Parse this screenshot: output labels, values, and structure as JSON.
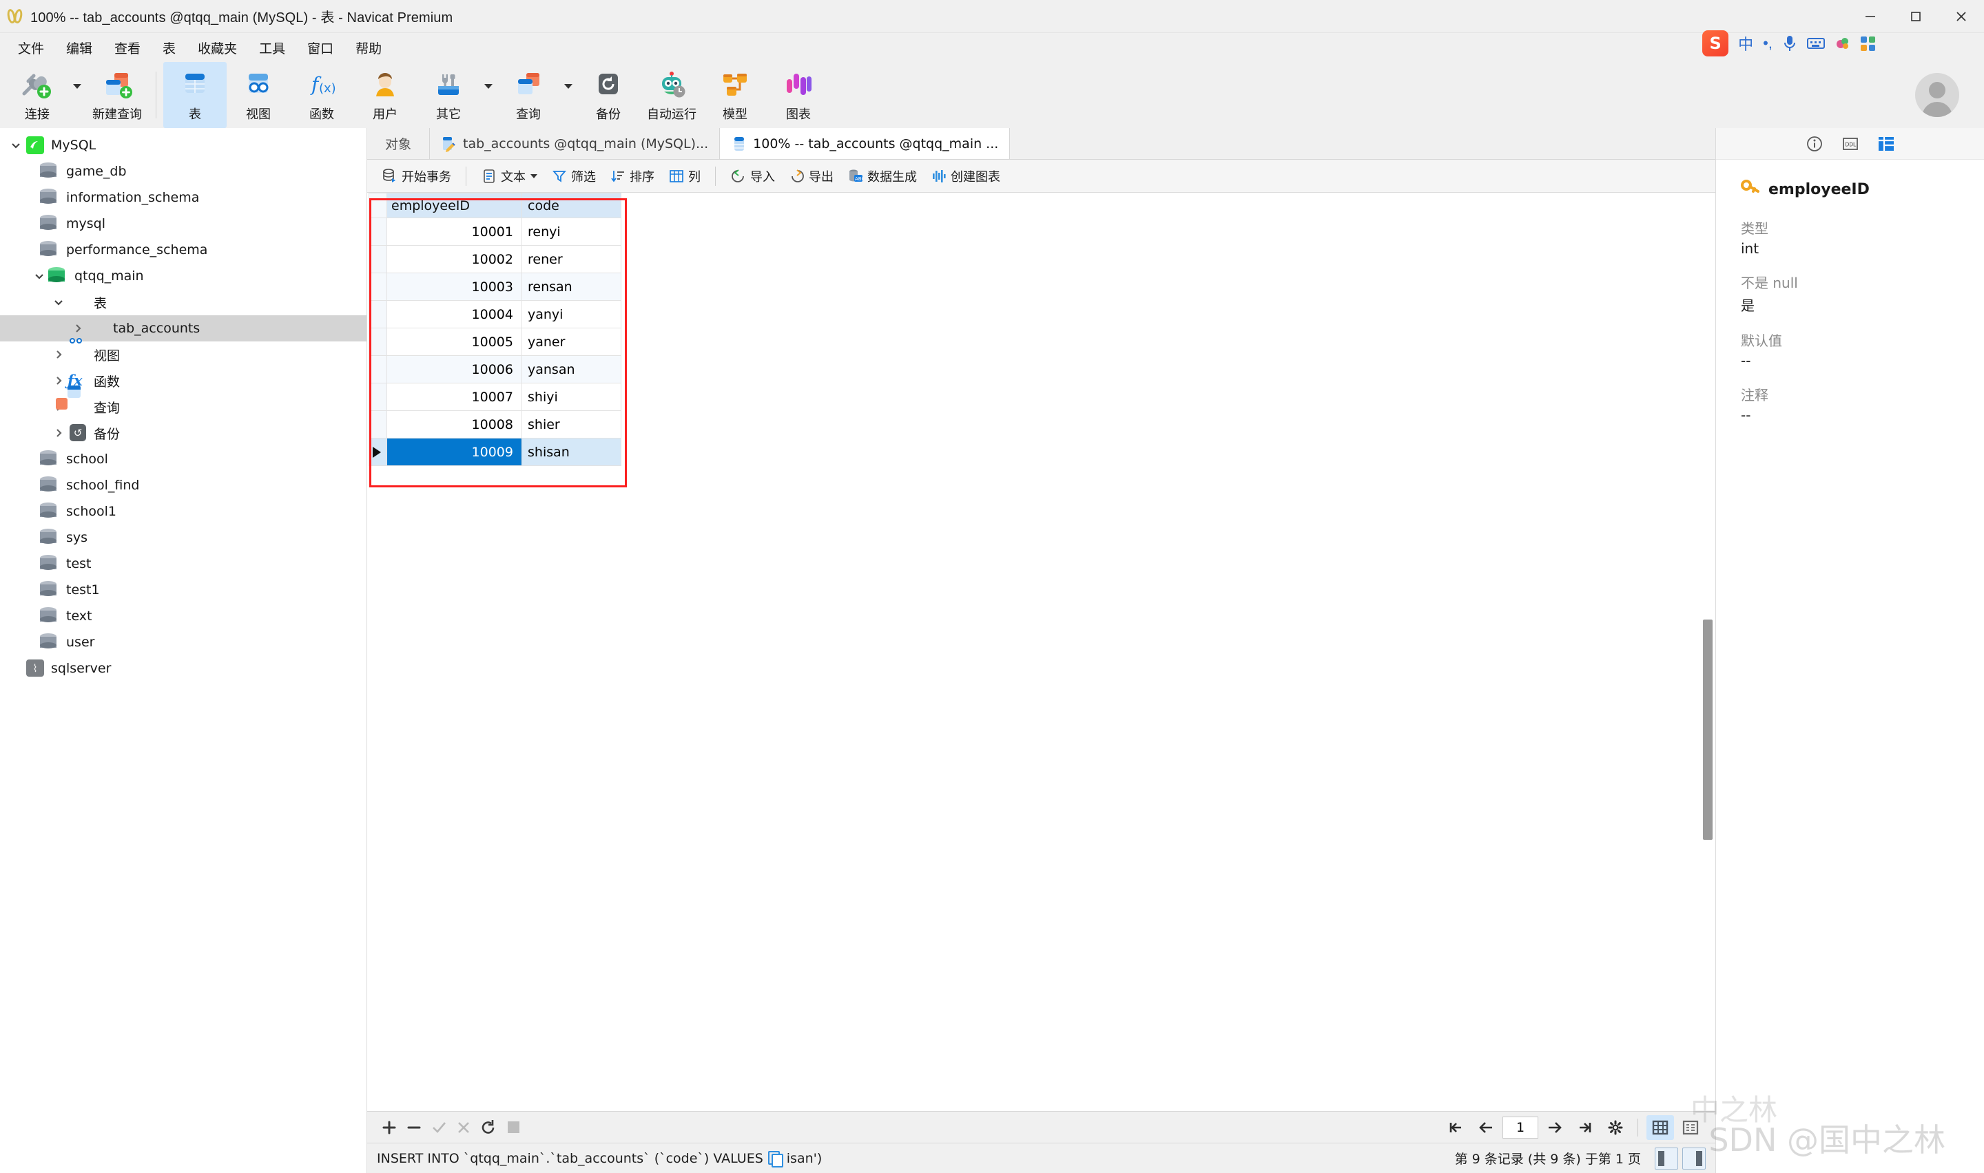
{
  "window": {
    "title": "100% -- tab_accounts @qtqq_main (MySQL) - 表 - Navicat Premium",
    "minimize": "—",
    "maximize": "▢",
    "close": "✕"
  },
  "menubar": {
    "items": [
      {
        "label": "文件"
      },
      {
        "label": "编辑"
      },
      {
        "label": "查看"
      },
      {
        "label": "表"
      },
      {
        "label": "收藏夹"
      },
      {
        "label": "工具"
      },
      {
        "label": "窗口"
      },
      {
        "label": "帮助"
      }
    ]
  },
  "ime": {
    "logo": "S",
    "mode": "中",
    "punct": "•,",
    "mic": "mic-icon",
    "keyboard": "keyboard-icon",
    "skin": "skin-icon",
    "apps": "apps-icon"
  },
  "ribbon": {
    "items": [
      {
        "label": "连接",
        "icon": "connection-icon",
        "has_dropdown": true,
        "active": false
      },
      {
        "label": "新建查询",
        "icon": "new-query-icon",
        "has_dropdown": false,
        "active": false
      },
      {
        "label": "表",
        "icon": "table-icon",
        "has_dropdown": false,
        "active": true
      },
      {
        "label": "视图",
        "icon": "view-icon",
        "has_dropdown": false,
        "active": false
      },
      {
        "label": "函数",
        "icon": "function-icon",
        "has_dropdown": false,
        "active": false
      },
      {
        "label": "用户",
        "icon": "user-icon",
        "has_dropdown": false,
        "active": false
      },
      {
        "label": "其它",
        "icon": "other-tools-icon",
        "has_dropdown": true,
        "active": false
      },
      {
        "label": "查询",
        "icon": "query-icon",
        "has_dropdown": true,
        "active": false
      },
      {
        "label": "备份",
        "icon": "backup-icon",
        "has_dropdown": false,
        "active": false
      },
      {
        "label": "自动运行",
        "icon": "automation-robot-icon",
        "has_dropdown": false,
        "active": false
      },
      {
        "label": "模型",
        "icon": "model-icon",
        "has_dropdown": false,
        "active": false
      },
      {
        "label": "图表",
        "icon": "chart-icon",
        "has_dropdown": false,
        "active": false
      }
    ]
  },
  "sidebar": {
    "nodes": [
      {
        "label": "MySQL",
        "icon": "mysql-connection-icon",
        "indent": 0,
        "twisty": "down",
        "selected": false
      },
      {
        "label": "game_db",
        "icon": "database-icon",
        "indent": 1,
        "twisty": "none",
        "selected": false
      },
      {
        "label": "information_schema",
        "icon": "database-icon",
        "indent": 1,
        "twisty": "none",
        "selected": false
      },
      {
        "label": "mysql",
        "icon": "database-icon",
        "indent": 1,
        "twisty": "none",
        "selected": false
      },
      {
        "label": "performance_schema",
        "icon": "database-icon",
        "indent": 1,
        "twisty": "none",
        "selected": false
      },
      {
        "label": "qtqq_main",
        "icon": "database-open-icon",
        "indent": 1,
        "twisty": "down",
        "selected": false
      },
      {
        "label": "表",
        "icon": "tables-folder-icon",
        "indent": 2,
        "twisty": "down",
        "selected": false
      },
      {
        "label": "tab_accounts",
        "icon": "table-icon",
        "indent": 3,
        "twisty": "right",
        "selected": true
      },
      {
        "label": "视图",
        "icon": "views-folder-icon",
        "indent": 2,
        "twisty": "right",
        "selected": false
      },
      {
        "label": "函数",
        "icon": "functions-folder-icon",
        "indent": 2,
        "twisty": "right",
        "selected": false
      },
      {
        "label": "查询",
        "icon": "queries-folder-icon",
        "indent": 2,
        "twisty": "right",
        "selected": false
      },
      {
        "label": "备份",
        "icon": "backups-folder-icon",
        "indent": 2,
        "twisty": "right",
        "selected": false
      },
      {
        "label": "school",
        "icon": "database-icon",
        "indent": 1,
        "twisty": "none",
        "selected": false
      },
      {
        "label": "school_find",
        "icon": "database-icon",
        "indent": 1,
        "twisty": "none",
        "selected": false
      },
      {
        "label": "school1",
        "icon": "database-icon",
        "indent": 1,
        "twisty": "none",
        "selected": false
      },
      {
        "label": "sys",
        "icon": "database-icon",
        "indent": 1,
        "twisty": "none",
        "selected": false
      },
      {
        "label": "test",
        "icon": "database-icon",
        "indent": 1,
        "twisty": "none",
        "selected": false
      },
      {
        "label": "test1",
        "icon": "database-icon",
        "indent": 1,
        "twisty": "none",
        "selected": false
      },
      {
        "label": "text",
        "icon": "database-icon",
        "indent": 1,
        "twisty": "none",
        "selected": false
      },
      {
        "label": "user",
        "icon": "database-icon",
        "indent": 1,
        "twisty": "none",
        "selected": false
      },
      {
        "label": "sqlserver",
        "icon": "sqlserver-connection-icon",
        "indent": 0,
        "twisty": "none",
        "selected": false
      }
    ]
  },
  "tabs": {
    "object_label": "对象",
    "items": [
      {
        "label": "tab_accounts @qtqq_main (MySQL)...",
        "icon": "table-design-icon",
        "active": false
      },
      {
        "label": "100% -- tab_accounts @qtqq_main ...",
        "icon": "table-data-icon",
        "active": true
      }
    ]
  },
  "subtoolbar": {
    "items": [
      {
        "label": "开始事务",
        "icon": "transaction-icon",
        "caret": false
      },
      {
        "label": "文本",
        "icon": "text-icon",
        "caret": true
      },
      {
        "label": "筛选",
        "icon": "filter-icon",
        "caret": false
      },
      {
        "label": "排序",
        "icon": "sort-icon",
        "caret": false
      },
      {
        "label": "列",
        "icon": "columns-icon",
        "caret": false
      },
      {
        "label": "导入",
        "icon": "import-icon",
        "caret": false
      },
      {
        "label": "导出",
        "icon": "export-icon",
        "caret": false
      },
      {
        "label": "数据生成",
        "icon": "data-generation-icon",
        "caret": false
      },
      {
        "label": "创建图表",
        "icon": "create-chart-icon",
        "caret": false
      }
    ]
  },
  "grid": {
    "columns": [
      "employeeID",
      "code"
    ],
    "rows": [
      {
        "employeeID": "10001",
        "code": "renyi"
      },
      {
        "employeeID": "10002",
        "code": "rener"
      },
      {
        "employeeID": "10003",
        "code": "rensan"
      },
      {
        "employeeID": "10004",
        "code": "yanyi"
      },
      {
        "employeeID": "10005",
        "code": "yaner"
      },
      {
        "employeeID": "10006",
        "code": "yansan"
      },
      {
        "employeeID": "10007",
        "code": "shiyi"
      },
      {
        "employeeID": "10008",
        "code": "shier"
      },
      {
        "employeeID": "10009",
        "code": "shisan"
      }
    ],
    "selected_row_index": 8,
    "highlight_color": "#fb2020",
    "selection_color": "#0478cf",
    "header_color": "#d6e7f7"
  },
  "editbar": {
    "buttons": [
      {
        "icon": "add-record-icon",
        "label": "+",
        "enabled": true
      },
      {
        "icon": "delete-record-icon",
        "label": "−",
        "enabled": true
      },
      {
        "icon": "apply-change-icon",
        "label": "✓",
        "enabled": false
      },
      {
        "icon": "cancel-change-icon",
        "label": "✕",
        "enabled": false
      },
      {
        "icon": "refresh-icon",
        "label": "⟳",
        "enabled": true
      },
      {
        "icon": "stop-icon",
        "label": "■",
        "enabled": false
      }
    ],
    "pager": {
      "first": "first-page-icon",
      "prev": "previous-page-icon",
      "page_value": "1",
      "next": "next-page-icon",
      "last": "last-page-icon",
      "settings": "grid-settings-icon",
      "grid_view": "grid-view-icon",
      "form_view": "form-view-icon"
    }
  },
  "statusbar": {
    "sql_prefix": "INSERT INTO `qtqq_main`.`tab_accounts` (`code`) VALUES",
    "copy_icon": "copy-icon",
    "sql_suffix": "isan')",
    "record_info": "第 9 条记录 (共 9 条) 于第 1 页"
  },
  "rightpanel": {
    "tabs": [
      {
        "icon": "info-icon",
        "active": false
      },
      {
        "icon": "ddl-icon",
        "active": false
      },
      {
        "icon": "field-structure-icon",
        "active": true
      }
    ],
    "field_name": "employeeID",
    "field_icon": "primary-key-icon",
    "fields": [
      {
        "key": "类型",
        "value": "int"
      },
      {
        "key": "不是 null",
        "value": "是"
      },
      {
        "key": "默认值",
        "value": "--"
      },
      {
        "key": "注释",
        "value": "--"
      }
    ]
  },
  "watermark": {
    "text": "SDN @国中之林",
    "text2": "中之林"
  }
}
